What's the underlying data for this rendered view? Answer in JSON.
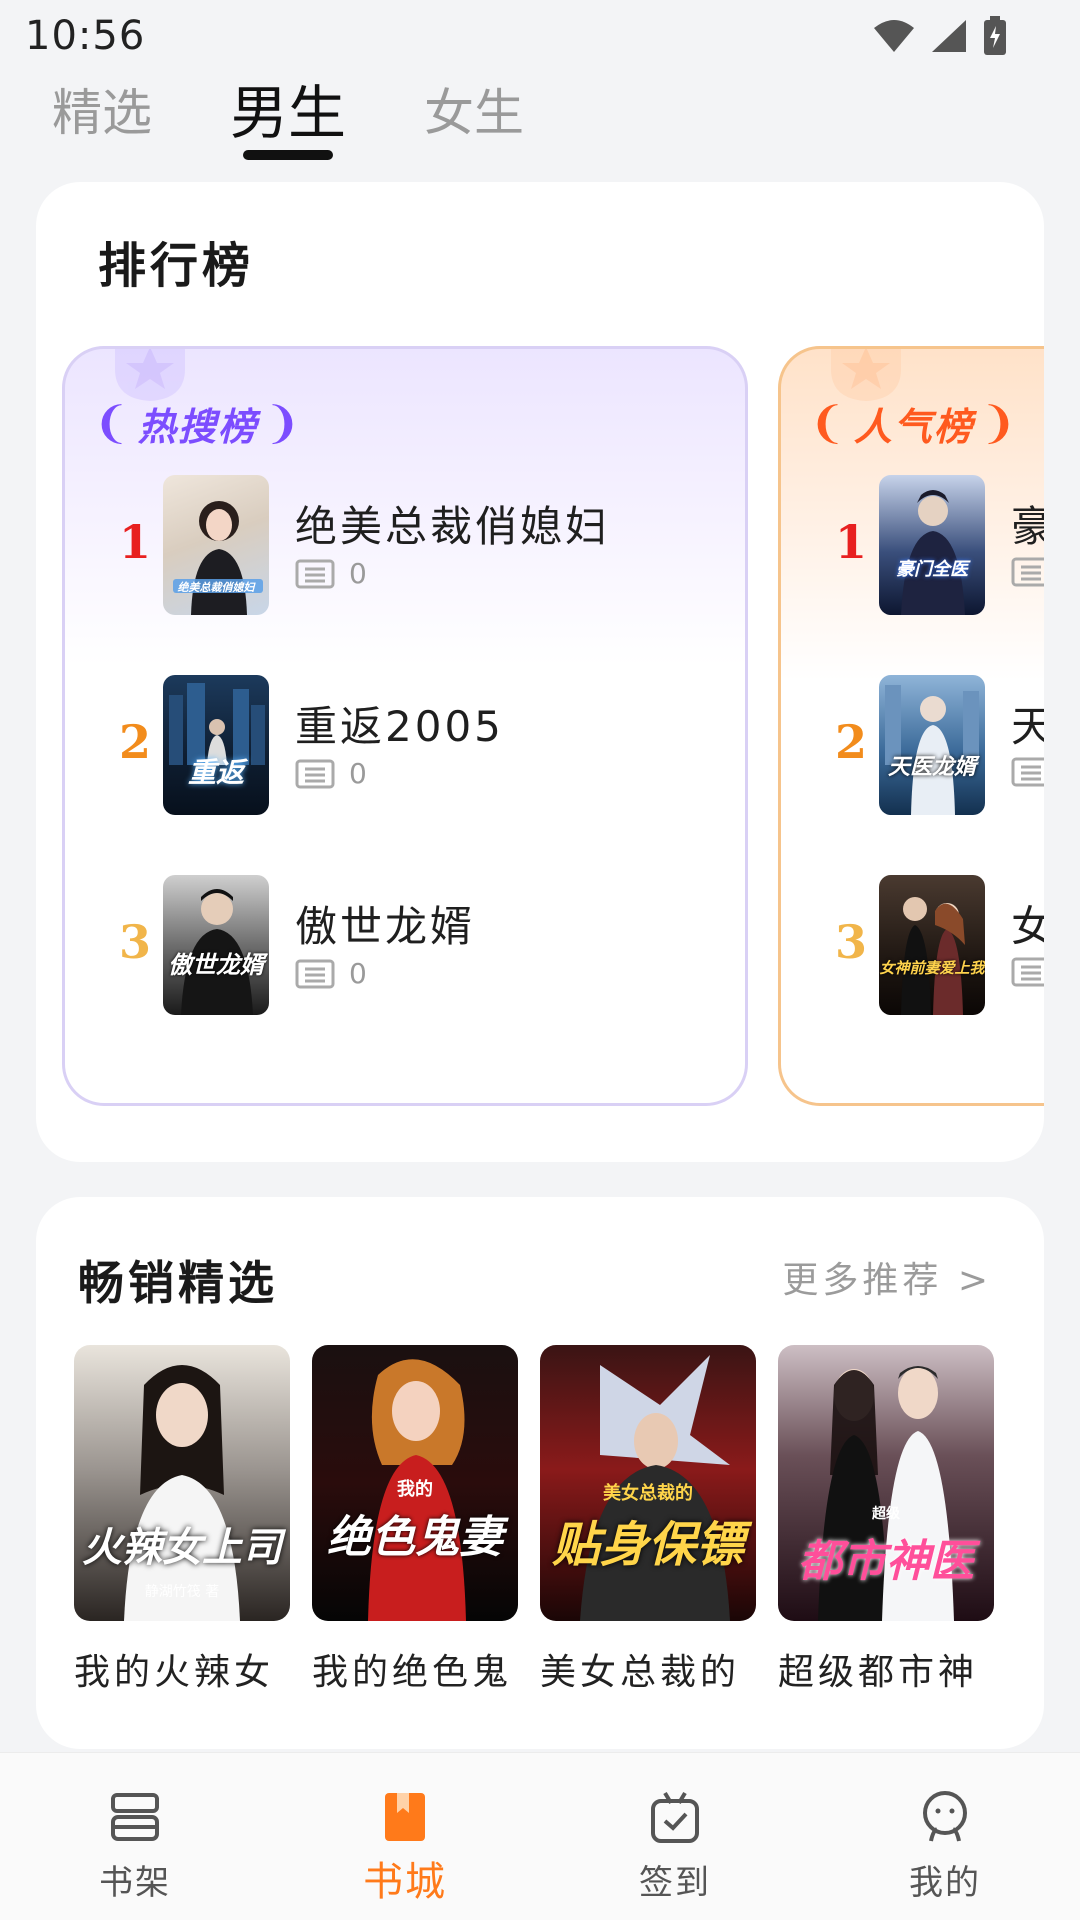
{
  "status_bar": {
    "time": "10:56"
  },
  "top_tabs": [
    {
      "label": "精选",
      "active": false
    },
    {
      "label": "男生",
      "active": true
    },
    {
      "label": "女生",
      "active": false
    }
  ],
  "ranking": {
    "title": "排行榜",
    "hot": {
      "badge": "热搜榜",
      "items": [
        {
          "rank": "1",
          "name": "绝美总裁俏媳妇",
          "count": "0",
          "cover_text": "绝美总裁俏媳妇"
        },
        {
          "rank": "2",
          "name": "重返2005",
          "count": "0",
          "cover_text": "重返"
        },
        {
          "rank": "3",
          "name": "傲世龙婿",
          "count": "0",
          "cover_text": "傲世龙婿"
        }
      ]
    },
    "popular": {
      "badge": "人气榜",
      "items": [
        {
          "rank": "1",
          "name": "豪",
          "count": "",
          "cover_text": "豪门全医"
        },
        {
          "rank": "2",
          "name": "天",
          "count": "",
          "cover_text": "天医龙婿"
        },
        {
          "rank": "3",
          "name": "女",
          "count": "",
          "cover_text": "女神前妻爱上我"
        }
      ]
    }
  },
  "bestsellers": {
    "title": "畅销精选",
    "more": "更多推荐 >",
    "books": [
      {
        "name": "我的火辣女",
        "cover_text": "火辣女上司",
        "cover_sub": "静湖竹筏 著"
      },
      {
        "name": "我的绝色鬼",
        "cover_text": "绝色鬼妻",
        "cover_sub": "我的"
      },
      {
        "name": "美女总裁的",
        "cover_text": "贴身保镖",
        "cover_sub": "美女总裁的"
      },
      {
        "name": "超级都市神",
        "cover_text": "都市神医",
        "cover_sub": "超级"
      }
    ]
  },
  "bottom_nav": [
    {
      "label": "书架",
      "icon": "bookshelf-icon",
      "active": false
    },
    {
      "label": "书城",
      "icon": "bookstore-icon",
      "active": true
    },
    {
      "label": "签到",
      "icon": "checkin-icon",
      "active": false
    },
    {
      "label": "我的",
      "icon": "profile-icon",
      "active": false
    }
  ],
  "colors": {
    "accent": "#ff7a1a",
    "hot": "#7c4dff",
    "popular": "#ff5a1f",
    "rank1": "#e82020",
    "rank2": "#f28c1c",
    "rank3": "#f1b54a"
  }
}
